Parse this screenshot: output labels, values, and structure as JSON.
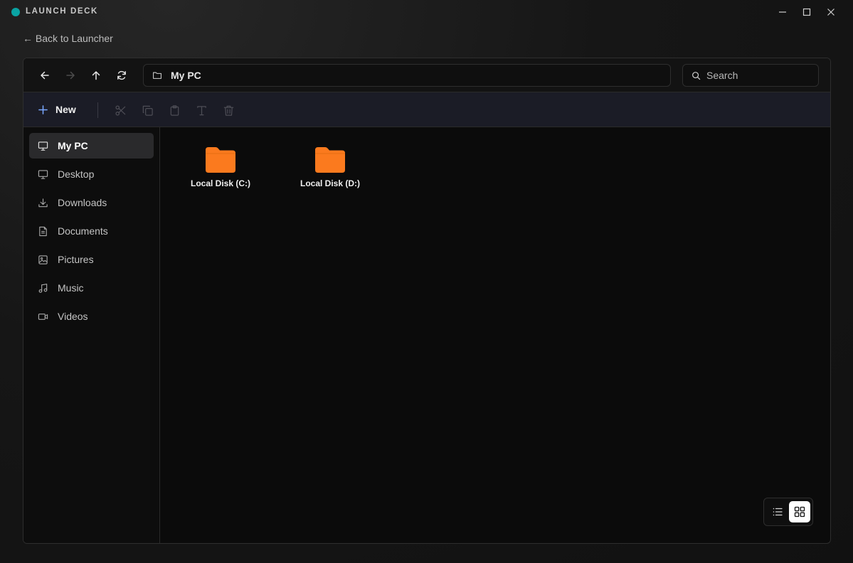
{
  "app": {
    "title": "LAUNCH DECK",
    "accent": "#0aa3a3"
  },
  "window_controls": [
    {
      "name": "minimize",
      "icon": "minimize-icon"
    },
    {
      "name": "maximize",
      "icon": "maximize-icon"
    },
    {
      "name": "close",
      "icon": "close-icon"
    }
  ],
  "back_link": "← Back to Launcher",
  "navbar": {
    "address": "My PC",
    "search_placeholder": "Search"
  },
  "toolbar": {
    "new_label": "New",
    "actions": [
      "cut",
      "copy",
      "paste",
      "rename",
      "delete"
    ]
  },
  "sidebar": {
    "items": [
      {
        "label": "My PC",
        "icon": "monitor-icon",
        "active": true
      },
      {
        "label": "Desktop",
        "icon": "desktop-icon",
        "active": false
      },
      {
        "label": "Downloads",
        "icon": "download-icon",
        "active": false
      },
      {
        "label": "Documents",
        "icon": "document-icon",
        "active": false
      },
      {
        "label": "Pictures",
        "icon": "image-icon",
        "active": false
      },
      {
        "label": "Music",
        "icon": "music-icon",
        "active": false
      },
      {
        "label": "Videos",
        "icon": "video-icon",
        "active": false
      }
    ]
  },
  "drives": [
    {
      "label": "Local Disk (C:)",
      "icon": "folder-icon",
      "color": "#fb7a1e"
    },
    {
      "label": "Local Disk (D:)",
      "icon": "folder-icon",
      "color": "#fb7a1e"
    }
  ],
  "view_mode": "grid"
}
